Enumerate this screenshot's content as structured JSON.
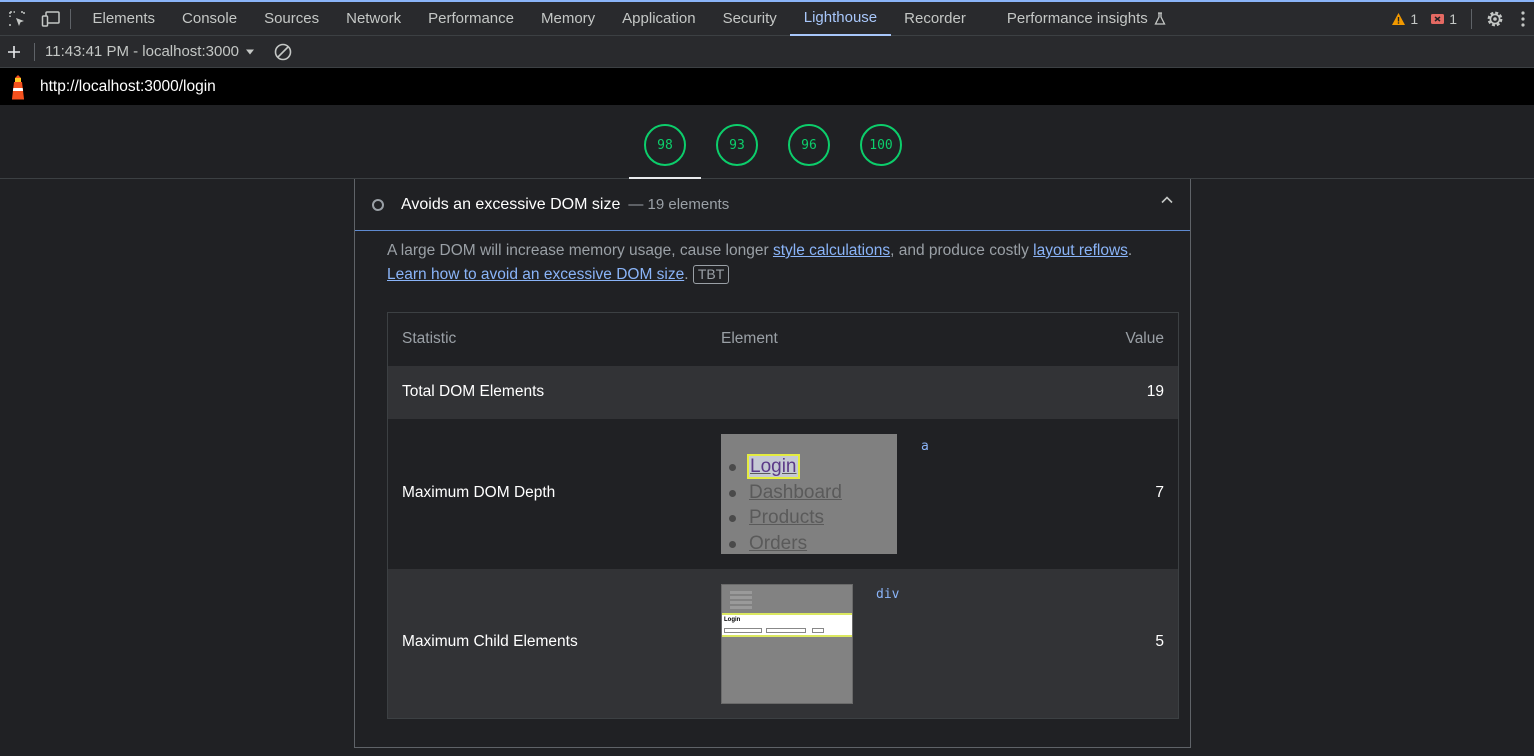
{
  "devtools": {
    "tabs": [
      "Elements",
      "Console",
      "Sources",
      "Network",
      "Performance",
      "Memory",
      "Application",
      "Security",
      "Lighthouse",
      "Recorder",
      "Performance insights"
    ],
    "active_tab": "Lighthouse",
    "warnings_count": "1",
    "errors_count": "1"
  },
  "toolbar": {
    "report_label": "11:43:41 PM - localhost:3000"
  },
  "urlbar": {
    "url": "http://localhost:3000/login"
  },
  "scores": [
    "98",
    "93",
    "96",
    "100"
  ],
  "audit": {
    "title": "Avoids an excessive DOM size",
    "display_value": "— 19 elements",
    "desc_part1": "A large DOM will increase memory usage, cause longer ",
    "link1": "style calculations",
    "desc_part2": ", and produce costly ",
    "link2": "layout reflows",
    "desc_part3": ".",
    "learn_link": "Learn how to avoid an excessive DOM size",
    "desc_part4": ".",
    "tag": "TBT",
    "table": {
      "headers": {
        "statistic": "Statistic",
        "element": "Element",
        "value": "Value"
      },
      "rows": [
        {
          "statistic": "Total DOM Elements",
          "element": "",
          "value": "19"
        },
        {
          "statistic": "Maximum DOM Depth",
          "node": "a",
          "value": "7",
          "preview_items": [
            "Login",
            "Dashboard",
            "Products",
            "Orders"
          ]
        },
        {
          "statistic": "Maximum Child Elements",
          "node": "div",
          "value": "5",
          "preview_label": "Login"
        }
      ]
    }
  },
  "colors": {
    "accent": "#a8c7fa",
    "score_pass": "#0cce6b",
    "warning": "#f29900",
    "error": "#e46962"
  }
}
